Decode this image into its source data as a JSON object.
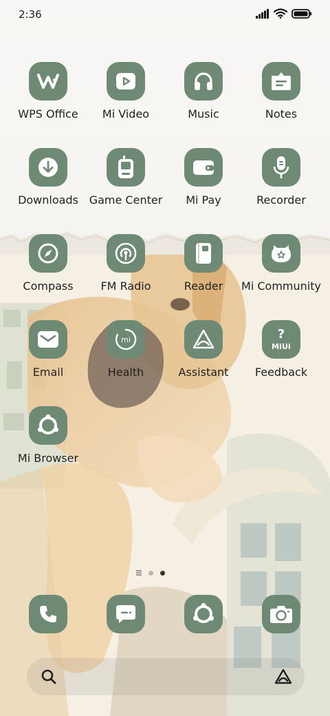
{
  "status_bar": {
    "time": "2:36",
    "icons": [
      "signal-icon",
      "wifi-icon",
      "battery-icon"
    ]
  },
  "theme": {
    "tile_color": "#6e8a74",
    "glyph_color": "#ffffff"
  },
  "apps": [
    {
      "label": "WPS Office",
      "icon": "wps-office-icon"
    },
    {
      "label": "Mi Video",
      "icon": "play-icon"
    },
    {
      "label": "Music",
      "icon": "headphones-icon"
    },
    {
      "label": "Notes",
      "icon": "notes-icon"
    },
    {
      "label": "Downloads",
      "icon": "download-icon"
    },
    {
      "label": "Game Center",
      "icon": "game-center-icon"
    },
    {
      "label": "Mi Pay",
      "icon": "wallet-icon"
    },
    {
      "label": "Recorder",
      "icon": "microphone-icon"
    },
    {
      "label": "Compass",
      "icon": "compass-icon"
    },
    {
      "label": "FM Radio",
      "icon": "radio-icon"
    },
    {
      "label": "Reader",
      "icon": "book-icon"
    },
    {
      "label": "Mi Community",
      "icon": "community-icon"
    },
    {
      "label": "Email",
      "icon": "envelope-icon"
    },
    {
      "label": "Health",
      "icon": "health-icon"
    },
    {
      "label": "Assistant",
      "icon": "assistant-icon"
    },
    {
      "label": "Feedback",
      "icon": "feedback-icon"
    },
    {
      "label": "Mi Browser",
      "icon": "browser-icon"
    }
  ],
  "feedback_badge": "MIUI",
  "health_badge": "mi",
  "page_indicator": {
    "pages": 2,
    "current": 2
  },
  "dock": [
    "phone-icon",
    "messages-icon",
    "browser-icon",
    "camera-icon"
  ],
  "search_bar": {
    "left_icon": "search-icon",
    "right_icon": "assistant-icon"
  }
}
